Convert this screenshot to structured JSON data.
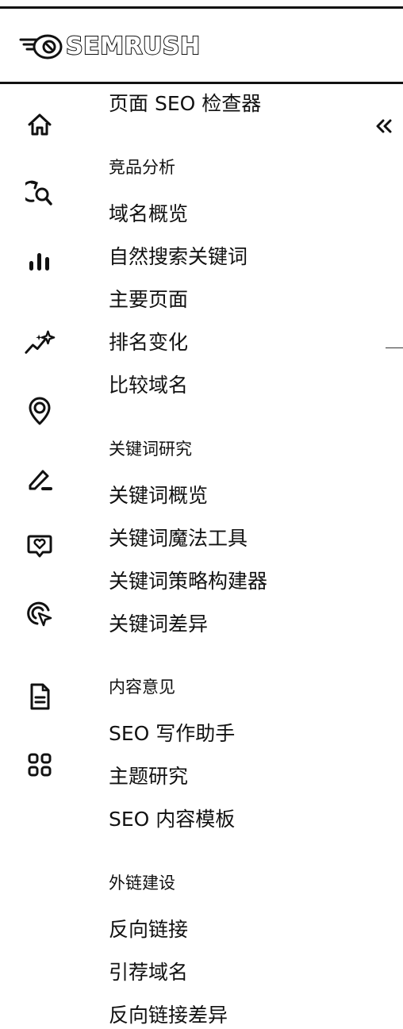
{
  "brand": {
    "name": "SEMRUSH"
  },
  "colors": {
    "text": "#111111",
    "background": "#ffffff"
  },
  "rail_icons": [
    "home-icon",
    "competitive-research-icon",
    "bar-chart-icon",
    "sparkle-trend-icon",
    "location-pin-icon",
    "pencil-icon",
    "chat-heart-icon",
    "target-cursor-icon",
    "document-icon",
    "apps-grid-icon"
  ],
  "collapse_label": "«",
  "menu": {
    "top_item": "页面 SEO 检查器",
    "sections": [
      {
        "heading": "竞品分析",
        "items": [
          "域名概览",
          "自然搜索关键词",
          "主要页面",
          "排名变化",
          "比较域名"
        ]
      },
      {
        "heading": "关键词研究",
        "items": [
          "关键词概览",
          "关键词魔法工具",
          "关键词策略构建器",
          "关键词差异"
        ]
      },
      {
        "heading": "内容意见",
        "items": [
          "SEO 写作助手",
          "主题研究",
          "SEO 内容模板"
        ]
      },
      {
        "heading": "外链建设",
        "items": [
          "反向链接",
          "引荐域名",
          "反向链接差异"
        ]
      }
    ]
  }
}
